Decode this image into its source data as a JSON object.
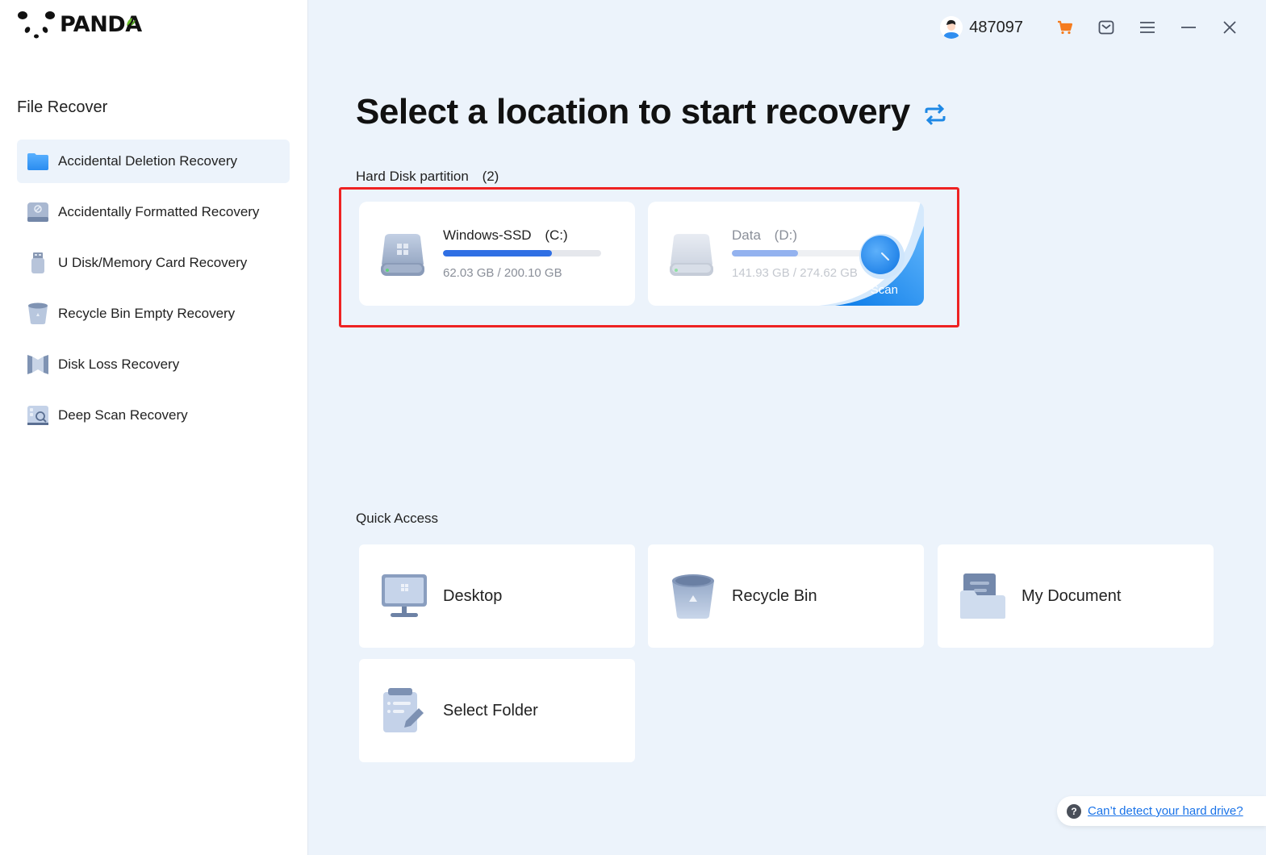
{
  "app": {
    "brand": "PANDA"
  },
  "sidebar": {
    "section_title": "File Recover",
    "items": [
      {
        "label": "Accidental Deletion Recovery",
        "icon": "folder-icon",
        "active": true
      },
      {
        "label": "Accidentally Formatted Recovery",
        "icon": "formatted-drive-icon",
        "active": false
      },
      {
        "label": "U Disk/Memory Card Recovery",
        "icon": "usb-drive-icon",
        "active": false
      },
      {
        "label": "Recycle Bin Empty Recovery",
        "icon": "recycle-bin-icon",
        "active": false
      },
      {
        "label": "Disk Loss Recovery",
        "icon": "disk-loss-icon",
        "active": false
      },
      {
        "label": "Deep Scan Recovery",
        "icon": "deep-scan-icon",
        "active": false
      }
    ]
  },
  "topbar": {
    "user_id": "487097",
    "icons": [
      "avatar",
      "cart-icon",
      "message-icon",
      "menu-icon",
      "minimize-icon",
      "close-icon"
    ],
    "accent_cart": "#f57c1f"
  },
  "main": {
    "title": "Select a location to start recovery",
    "partitions_label": "Hard Disk partition",
    "partitions_count": "(2)",
    "partitions": [
      {
        "name": "Windows-SSD",
        "letter": "(C:)",
        "used": "62.03 GB",
        "total": "200.10 GB",
        "size_text": "62.03 GB / 200.10 GB",
        "bar_fill_pct": 69,
        "hover": false
      },
      {
        "name": "Data",
        "letter": "(D:)",
        "used": "141.93 GB",
        "total": "274.62 GB",
        "size_text": "141.93 GB / 274.62 GB",
        "bar_fill_pct": 48,
        "hover": true,
        "scan_label": "Scan"
      }
    ],
    "quick_access_label": "Quick Access",
    "quick_access": [
      {
        "label": "Desktop",
        "icon": "desktop-icon"
      },
      {
        "label": "Recycle Bin",
        "icon": "recycle-bin-icon"
      },
      {
        "label": "My Document",
        "icon": "document-folder-icon"
      },
      {
        "label": "Select Folder",
        "icon": "select-folder-icon"
      }
    ],
    "help_link": "Can’t detect your hard drive?"
  },
  "colors": {
    "accent": "#2f6fe4",
    "highlight_border": "#ee2222",
    "background": "#ecf3fb",
    "link": "#1a73e8"
  }
}
